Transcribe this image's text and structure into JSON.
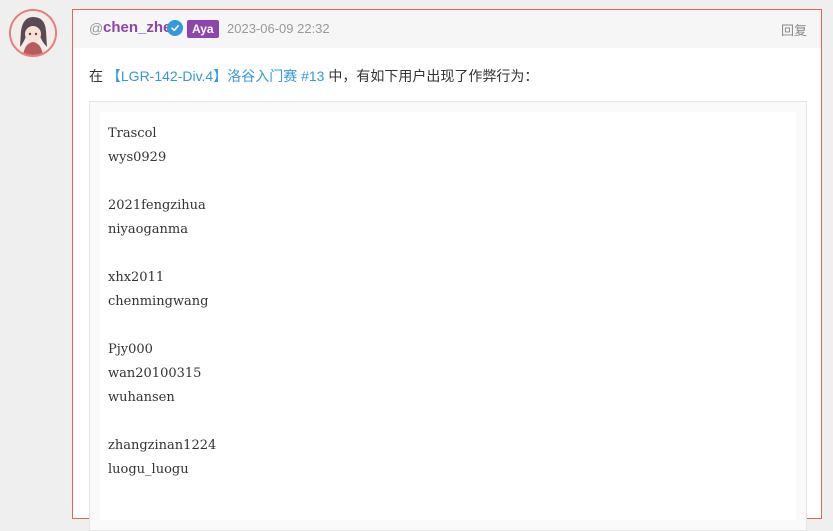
{
  "post": {
    "at_symbol": "@",
    "username": "chen_zhe",
    "badge": "Aya",
    "timestamp": "2023-06-09 22:32",
    "reply_label": "回复",
    "intro_prefix": "在 ",
    "contest_link": "【LGR-142-Div.4】洛谷入门赛 #13",
    "intro_suffix": " 中，有如下用户出现了作弊行为：",
    "code_lines": [
      "Trascol",
      "wys0929",
      "",
      "2021fengzihua",
      "niyaoganma",
      "",
      "xhx2011",
      "chenmingwang",
      "",
      "Pjy000",
      "wan20100315",
      "wuhansen",
      "",
      "zhangzinan1224",
      "luogu_luogu"
    ]
  },
  "colors": {
    "username": "#8e44ad",
    "badge_bg": "#8e44ad",
    "link": "#3498db",
    "card_border": "#e3665d"
  },
  "icons": {
    "avatar": "avatar-image",
    "verify": "verified-check-icon"
  }
}
